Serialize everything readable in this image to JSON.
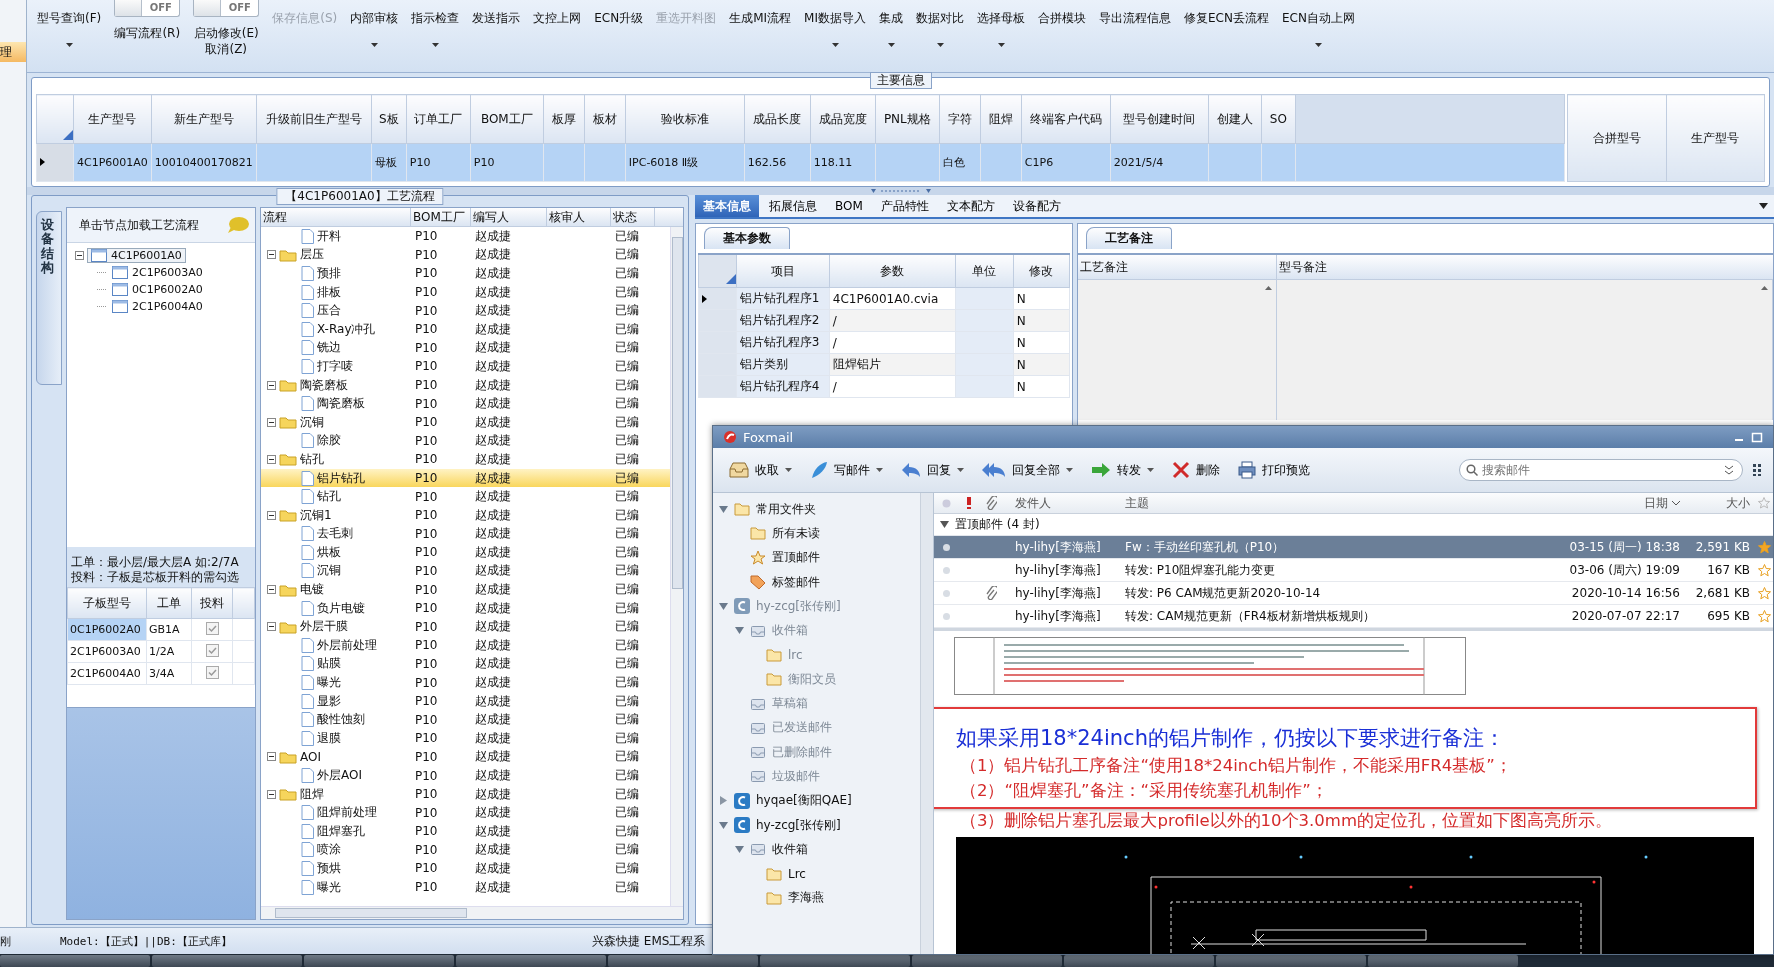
{
  "nav": [
    {
      "label": "理",
      "selected": true
    }
  ],
  "toolbar": [
    {
      "kind": "button",
      "label": "型号查询(F)",
      "caret": true,
      "disabled": false
    },
    {
      "kind": "toggle",
      "state": "OFF",
      "on": false,
      "label": "编写流程(R)"
    },
    {
      "kind": "toggle",
      "state": "OFF",
      "on": false,
      "label": "启动修改(E)",
      "label2": "取消(Z)"
    },
    {
      "kind": "button",
      "label": "保存信息(S)",
      "caret": false,
      "disabled": true
    },
    {
      "kind": "button",
      "label": "内部审核",
      "caret": true,
      "disabled": false
    },
    {
      "kind": "button",
      "label": "指示检查",
      "caret": true,
      "disabled": false
    },
    {
      "kind": "button",
      "label": "发送指示",
      "caret": false,
      "disabled": false
    },
    {
      "kind": "button",
      "label": "文控上网",
      "caret": false,
      "disabled": false
    },
    {
      "kind": "button",
      "label": "ECN升级",
      "caret": false,
      "disabled": false
    },
    {
      "kind": "button",
      "label": "重选开料图",
      "caret": false,
      "disabled": true
    },
    {
      "kind": "button",
      "label": "生成MI流程",
      "caret": false,
      "disabled": false
    },
    {
      "kind": "button",
      "label": "MI数据导入",
      "caret": true,
      "disabled": false
    },
    {
      "kind": "button",
      "label": "集成",
      "caret": true,
      "disabled": false
    },
    {
      "kind": "button",
      "label": "数据对比",
      "caret": true,
      "disabled": false
    },
    {
      "kind": "button",
      "label": "选择母板",
      "caret": true,
      "disabled": false
    },
    {
      "kind": "button",
      "label": "合拼模块",
      "caret": false,
      "disabled": false
    },
    {
      "kind": "button",
      "label": "导出流程信息",
      "caret": false,
      "disabled": false
    },
    {
      "kind": "button",
      "label": "修复ECN丢流程",
      "caret": false,
      "disabled": false
    },
    {
      "kind": "button",
      "label": "ECN自动上网",
      "caret": true,
      "disabled": false
    }
  ],
  "main_info": {
    "title": "主要信息",
    "columns": [
      "生产型号",
      "新生产型号",
      "升级前旧生产型号",
      "S板",
      "订单工厂",
      "BOM工厂",
      "板厚",
      "板材",
      "验收标准",
      "成品长度",
      "成品宽度",
      "PNL规格",
      "字符",
      "阻焊",
      "终端客户代码",
      "型号创建时间",
      "创建人",
      "SO"
    ],
    "rows": [
      {
        "selected": true,
        "cells": [
          "4C1P6001A0",
          "10010400170821",
          null,
          "母板",
          "P10",
          "P10",
          null,
          null,
          "IPC-6018 Ⅱ级",
          "162.56",
          "118.11",
          null,
          "白色",
          null,
          "C1P6",
          "2021/5/4",
          null,
          null
        ]
      }
    ],
    "merge_columns": [
      "合拼型号",
      "生产型号"
    ]
  },
  "structure": {
    "title": "【4C1P6001A0】工艺流程",
    "side_tab": "设备结构",
    "hint": "单击节点加载工艺流程",
    "tree": [
      {
        "label": "4C1P6001A0",
        "selected": true,
        "expanded": true,
        "children": [
          {
            "label": "2C1P6003A0",
            "selected": false
          },
          {
            "label": "0C1P6002A0",
            "selected": false
          },
          {
            "label": "2C1P6004A0",
            "selected": false
          }
        ]
      }
    ],
    "notes": [
      "工单：最小层/最大层A 如:2/7A",
      "投料：子板是芯板开料的需勾选"
    ],
    "part_columns": [
      "子板型号",
      "工单",
      "投料"
    ],
    "parts": [
      {
        "model": "0C1P6002A0",
        "order": "GB1A",
        "checked": true,
        "selected": true
      },
      {
        "model": "2C1P6003A0",
        "order": "1/2A",
        "checked": true,
        "selected": false
      },
      {
        "model": "2C1P6004A0",
        "order": "3/4A",
        "checked": true,
        "selected": false
      }
    ]
  },
  "flow": {
    "columns": [
      "流程",
      "BOM工厂",
      "编写人",
      "核审人",
      "状态"
    ],
    "rows": [
      {
        "name": "开料",
        "bom": "P10",
        "writer": "赵成捷",
        "status": "已编",
        "selected": false
      },
      {
        "name": "层压",
        "bom": "P10",
        "writer": "赵成捷",
        "status": "已编",
        "selected": false,
        "expanded": true,
        "children": [
          {
            "name": "预排",
            "bom": "P10",
            "writer": "赵成捷",
            "status": "已编",
            "selected": false
          },
          {
            "name": "排板",
            "bom": "P10",
            "writer": "赵成捷",
            "status": "已编",
            "selected": false
          },
          {
            "name": "压合",
            "bom": "P10",
            "writer": "赵成捷",
            "status": "已编",
            "selected": false
          },
          {
            "name": "X-Ray冲孔",
            "bom": "P10",
            "writer": "赵成捷",
            "status": "已编",
            "selected": false
          },
          {
            "name": "铣边",
            "bom": "P10",
            "writer": "赵成捷",
            "status": "已编",
            "selected": false
          },
          {
            "name": "打字唛",
            "bom": "P10",
            "writer": "赵成捷",
            "status": "已编",
            "selected": false
          }
        ]
      },
      {
        "name": "陶瓷磨板",
        "bom": "P10",
        "writer": "赵成捷",
        "status": "已编",
        "selected": false,
        "expanded": true,
        "children": [
          {
            "name": "陶瓷磨板",
            "bom": "P10",
            "writer": "赵成捷",
            "status": "已编",
            "selected": false
          }
        ]
      },
      {
        "name": "沉铜",
        "bom": "P10",
        "writer": "赵成捷",
        "status": "已编",
        "selected": false,
        "expanded": true,
        "children": [
          {
            "name": "除胶",
            "bom": "P10",
            "writer": "赵成捷",
            "status": "已编",
            "selected": false
          }
        ]
      },
      {
        "name": "钻孔",
        "bom": "P10",
        "writer": "赵成捷",
        "status": "已编",
        "selected": false,
        "expanded": true,
        "children": [
          {
            "name": "铝片钻孔",
            "bom": "P10",
            "writer": "赵成捷",
            "status": "已编",
            "selected": true
          },
          {
            "name": "钻孔",
            "bom": "P10",
            "writer": "赵成捷",
            "status": "已编",
            "selected": false
          }
        ]
      },
      {
        "name": "沉铜1",
        "bom": "P10",
        "writer": "赵成捷",
        "status": "已编",
        "selected": false,
        "expanded": true,
        "children": [
          {
            "name": "去毛刺",
            "bom": "P10",
            "writer": "赵成捷",
            "status": "已编",
            "selected": false
          },
          {
            "name": "烘板",
            "bom": "P10",
            "writer": "赵成捷",
            "status": "已编",
            "selected": false
          },
          {
            "name": "沉铜",
            "bom": "P10",
            "writer": "赵成捷",
            "status": "已编",
            "selected": false
          }
        ]
      },
      {
        "name": "电镀",
        "bom": "P10",
        "writer": "赵成捷",
        "status": "已编",
        "selected": false,
        "expanded": true,
        "children": [
          {
            "name": "负片电镀",
            "bom": "P10",
            "writer": "赵成捷",
            "status": "已编",
            "selected": false
          }
        ]
      },
      {
        "name": "外层干膜",
        "bom": "P10",
        "writer": "赵成捷",
        "status": "已编",
        "selected": false,
        "expanded": true,
        "children": [
          {
            "name": "外层前处理",
            "bom": "P10",
            "writer": "赵成捷",
            "status": "已编",
            "selected": false
          },
          {
            "name": "贴膜",
            "bom": "P10",
            "writer": "赵成捷",
            "status": "已编",
            "selected": false
          },
          {
            "name": "曝光",
            "bom": "P10",
            "writer": "赵成捷",
            "status": "已编",
            "selected": false
          },
          {
            "name": "显影",
            "bom": "P10",
            "writer": "赵成捷",
            "status": "已编",
            "selected": false
          },
          {
            "name": "酸性蚀刻",
            "bom": "P10",
            "writer": "赵成捷",
            "status": "已编",
            "selected": false
          },
          {
            "name": "退膜",
            "bom": "P10",
            "writer": "赵成捷",
            "status": "已编",
            "selected": false
          }
        ]
      },
      {
        "name": "AOI",
        "bom": "P10",
        "writer": "赵成捷",
        "status": "已编",
        "selected": false,
        "expanded": true,
        "children": [
          {
            "name": "外层AOI",
            "bom": "P10",
            "writer": "赵成捷",
            "status": "已编",
            "selected": false
          }
        ]
      },
      {
        "name": "阻焊",
        "bom": "P10",
        "writer": "赵成捷",
        "status": "已编",
        "selected": false,
        "expanded": true,
        "children": [
          {
            "name": "阻焊前处理",
            "bom": "P10",
            "writer": "赵成捷",
            "status": "已编",
            "selected": false
          },
          {
            "name": "阻焊塞孔",
            "bom": "P10",
            "writer": "赵成捷",
            "status": "已编",
            "selected": false
          },
          {
            "name": "喷涂",
            "bom": "P10",
            "writer": "赵成捷",
            "status": "已编",
            "selected": false
          },
          {
            "name": "预烘",
            "bom": "P10",
            "writer": "赵成捷",
            "status": "已编",
            "selected": false
          },
          {
            "name": "曝光",
            "bom": "P10",
            "writer": "赵成捷",
            "status": "已编",
            "selected": false
          }
        ]
      }
    ]
  },
  "detail_tabs": [
    {
      "label": "基本信息",
      "selected": true
    },
    {
      "label": "拓展信息",
      "selected": false
    },
    {
      "label": "BOM",
      "selected": false
    },
    {
      "label": "产品特性",
      "selected": false
    },
    {
      "label": "文本配方",
      "selected": false
    },
    {
      "label": "设备配方",
      "selected": false
    }
  ],
  "params": {
    "tab": "基本参数",
    "columns": [
      "项目",
      "参数",
      "单位",
      "修改"
    ],
    "rows": [
      {
        "item": "铝片钻孔程序1",
        "value": "4C1P6001A0.cvia",
        "modified": "N",
        "selected": true
      },
      {
        "item": "铝片钻孔程序2",
        "value": "/",
        "modified": "N",
        "selected": false
      },
      {
        "item": "铝片钻孔程序3",
        "value": "/",
        "modified": "N",
        "selected": false
      },
      {
        "item": "铝片类别",
        "value": "阻焊铝片",
        "modified": "N",
        "selected": false
      },
      {
        "item": "铝片钻孔程序4",
        "value": "/",
        "modified": "N",
        "selected": false
      }
    ]
  },
  "remarks": {
    "tab": "工艺备注",
    "columns": [
      "工艺备注",
      "型号备注"
    ]
  },
  "status_bar": {
    "left": "刚",
    "model": "Model:【正式】||DB:【正式库】",
    "company": "兴森快捷 EMS工程系"
  },
  "mail": {
    "title": "Foxmail",
    "toolbar": [
      {
        "kind": "receive",
        "label": "收取",
        "caret": true
      },
      {
        "kind": "compose",
        "label": "写邮件",
        "caret": true
      },
      {
        "kind": "reply",
        "label": "回复",
        "caret": true
      },
      {
        "kind": "replyall",
        "label": "回复全部",
        "caret": true
      },
      {
        "kind": "forward",
        "label": "转发",
        "caret": true
      },
      {
        "kind": "delete",
        "label": "删除",
        "caret": false
      },
      {
        "kind": "print",
        "label": "打印预览",
        "caret": false
      }
    ],
    "search": {
      "placeholder": "搜索邮件"
    },
    "folders": [
      {
        "kind": "folder",
        "label": "常用文件夹",
        "expanded": true,
        "children": [
          {
            "kind": "folder",
            "label": "所有未读"
          },
          {
            "kind": "star",
            "label": "置顶邮件"
          },
          {
            "kind": "tag",
            "label": "标签邮件"
          }
        ]
      },
      {
        "kind": "account",
        "label": "hy-zcg[张传刚]",
        "disabled": true,
        "expanded": true,
        "children": [
          {
            "kind": "inbox",
            "label": "收件箱",
            "expanded": true,
            "children": [
              {
                "kind": "folder",
                "label": "lrc"
              },
              {
                "kind": "folder",
                "label": "衡阳文员"
              }
            ]
          },
          {
            "kind": "draft",
            "label": "草稿箱"
          },
          {
            "kind": "sent",
            "label": "已发送邮件"
          },
          {
            "kind": "trash",
            "label": "已删除邮件"
          },
          {
            "kind": "junk",
            "label": "垃圾邮件"
          }
        ]
      },
      {
        "kind": "account",
        "label": "hyqae[衡阳QAE]",
        "disabled": false,
        "expanded": false
      },
      {
        "kind": "account",
        "label": "hy-zcg[张传刚]",
        "disabled": false,
        "expanded": true,
        "children": [
          {
            "kind": "inbox",
            "label": "收件箱",
            "expanded": true,
            "children": [
              {
                "kind": "folder",
                "label": "Lrc"
              },
              {
                "kind": "folder",
                "label": "李海燕"
              }
            ]
          }
        ]
      }
    ],
    "list_columns": {
      "sender": "发件人",
      "subject": "主题",
      "date": "日期",
      "size": "大小"
    },
    "group": "置顶邮件 (4 封)",
    "messages": [
      {
        "sender": "hy-lihy[李海燕]",
        "subject": "Fw：手动丝印塞孔机（P10）",
        "date": "03-15 (周一) 18:38",
        "size": "2,591 KB",
        "attachment": false,
        "starred": true,
        "selected": true
      },
      {
        "sender": "hy-lihy[李海燕]",
        "subject": "转发: P10阻焊塞孔能力变更",
        "date": "03-06 (周六) 19:09",
        "size": "167 KB",
        "attachment": false,
        "starred": false,
        "selected": false
      },
      {
        "sender": "hy-lihy[李海燕]",
        "subject": "转发: P6 CAM规范更新2020-10-14",
        "date": "2020-10-14 16:56",
        "size": "2,681 KB",
        "attachment": true,
        "starred": false,
        "selected": false
      },
      {
        "sender": "hy-lihy[李海燕]",
        "subject": "转发: CAM规范更新（FR4板材新增烘板规则）",
        "date": "2020-07-07 22:17",
        "size": "695 KB",
        "attachment": false,
        "starred": false,
        "selected": false
      }
    ],
    "preview": [
      {
        "kind": "heading",
        "text": "如果采用18*24inch的铝片制作，仍按以下要求进行备注：",
        "boxed": true
      },
      {
        "kind": "note",
        "text": "（1）铝片钻孔工序备注“使用18*24inch铝片制作，不能采用FR4基板”；",
        "boxed": true
      },
      {
        "kind": "note",
        "text": "（2）“阻焊塞孔”备注：“采用传统塞孔机制作”；",
        "boxed": true
      },
      {
        "kind": "note",
        "text": "（3）删除铝片塞孔层最大profile以外的10个3.0mm的定位孔，位置如下图高亮所示。",
        "boxed": false
      }
    ]
  }
}
